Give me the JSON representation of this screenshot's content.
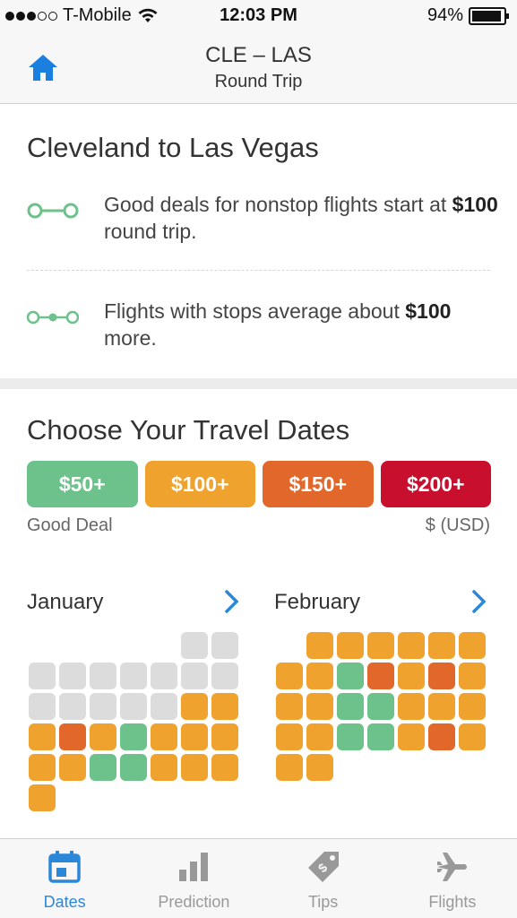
{
  "status": {
    "carrier": "T-Mobile",
    "time": "12:03 PM",
    "battery": "94%",
    "battery_level": 0.94
  },
  "nav": {
    "title": "CLE – LAS",
    "subtitle": "Round Trip",
    "home_icon": "home-icon"
  },
  "route": {
    "title": "Cleveland to Las Vegas",
    "nonstop": {
      "text_before": "Good deals for nonstop flights start at ",
      "price": "$100",
      "text_after": " round trip."
    },
    "stops": {
      "text_before": "Flights with stops average about ",
      "price": "$100",
      "text_after": " more."
    }
  },
  "dates": {
    "title": "Choose Your Travel Dates",
    "legend": [
      {
        "label": "$50+",
        "color": "#6cc28a"
      },
      {
        "label": "$100+",
        "color": "#f0a22e"
      },
      {
        "label": "$150+",
        "color": "#e2672a"
      },
      {
        "label": "$200+",
        "color": "#c8102e"
      }
    ],
    "legend_left": "Good Deal",
    "legend_right": "$ (USD)"
  },
  "months": [
    {
      "name": "January",
      "cells": [
        "empty",
        "empty",
        "empty",
        "empty",
        "empty",
        "gray",
        "gray",
        "gray",
        "gray",
        "gray",
        "gray",
        "gray",
        "gray",
        "gray",
        "gray",
        "gray",
        "gray",
        "gray",
        "gray",
        "orange",
        "orange",
        "orange",
        "dark",
        "orange",
        "green",
        "orange",
        "orange",
        "orange",
        "orange",
        "orange",
        "green",
        "green",
        "orange",
        "orange",
        "orange",
        "orange"
      ]
    },
    {
      "name": "February",
      "cells": [
        "empty",
        "orange",
        "orange",
        "orange",
        "orange",
        "orange",
        "orange",
        "orange",
        "orange",
        "green",
        "dark",
        "orange",
        "dark",
        "orange",
        "orange",
        "orange",
        "green",
        "green",
        "orange",
        "orange",
        "orange",
        "orange",
        "orange",
        "green",
        "green",
        "orange",
        "dark",
        "orange",
        "orange",
        "orange"
      ]
    }
  ],
  "tabs": [
    {
      "label": "Dates",
      "icon": "calendar-icon",
      "active": true
    },
    {
      "label": "Prediction",
      "icon": "bar-chart-icon",
      "active": false
    },
    {
      "label": "Tips",
      "icon": "tag-icon",
      "active": false
    },
    {
      "label": "Flights",
      "icon": "airplane-icon",
      "active": false
    }
  ]
}
